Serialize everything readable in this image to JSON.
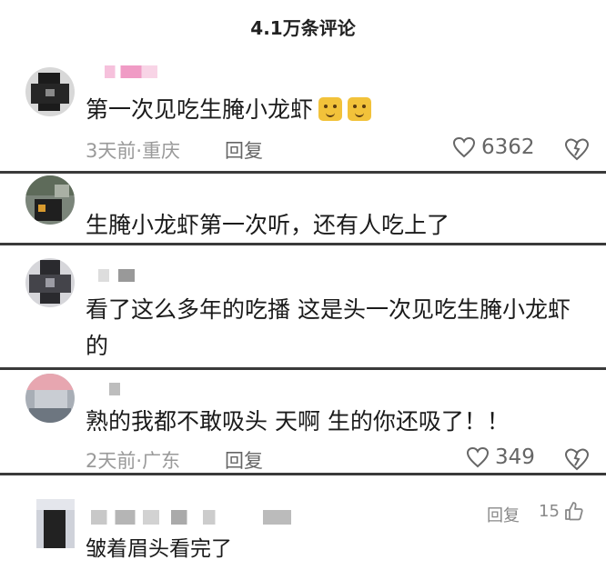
{
  "header": {
    "title": "4.1万条评论"
  },
  "comments": [
    {
      "text": "第一次见吃生腌小龙虾",
      "emoji_count": 2,
      "emoji_name": "cat-face-emoji",
      "time": "3天前",
      "location": "重庆",
      "reply_label": "回复",
      "likes": "6362"
    },
    {
      "text": "生腌小龙虾第一次听，还有人吃上了"
    },
    {
      "text_line1": "看了这么多年的吃播 这是头一次见吃生腌小龙虾",
      "text_line2": "的"
    },
    {
      "text": "熟的我都不敢吸头 天啊 生的你还吸了！！",
      "time": "2天前",
      "location": "广东",
      "reply_label": "回复",
      "likes": "349"
    },
    {
      "text": "皱着眉头看完了",
      "reply_label": "回复",
      "likes": "15"
    }
  ],
  "separator": "·",
  "colors": {
    "divider": "#3a3a3a",
    "meta": "#9a9a9a",
    "text": "#1b1b1b"
  }
}
